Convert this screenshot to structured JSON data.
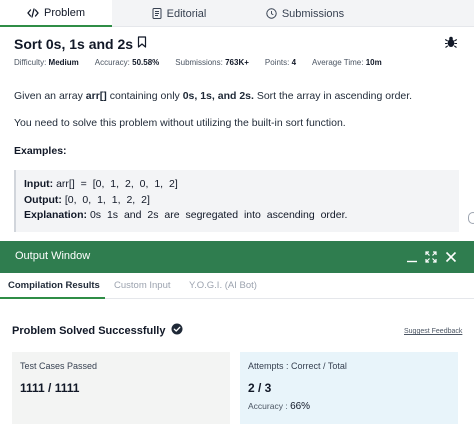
{
  "tabs": {
    "problem": "Problem",
    "editorial": "Editorial",
    "submissions": "Submissions"
  },
  "problem": {
    "title": "Sort 0s, 1s and 2s",
    "meta": {
      "difficulty_label": "Difficulty:",
      "difficulty": "Medium",
      "accuracy_label": "Accuracy:",
      "accuracy": "50.58%",
      "submissions_label": "Submissions:",
      "submissions": "763K+",
      "points_label": "Points:",
      "points": "4",
      "avg_time_label": "Average Time:",
      "avg_time": "10m"
    },
    "desc_pre": "Given an array ",
    "desc_arr": "arr[]",
    "desc_mid": " containing only ",
    "desc_vals": "0s, 1s, and 2s.",
    "desc_post": " Sort the array in ascending order.",
    "note": "You need to solve this problem without utilizing the built-in sort function.",
    "examples_heading": "Examples:",
    "example": {
      "input_label": "Input:",
      "input_value": "arr[] = [0, 1, 2, 0, 1, 2]",
      "output_label": "Output:",
      "output_value": "[0, 0, 1, 1, 2, 2]",
      "explanation_label": "Explanation:",
      "explanation_value": "0s 1s and 2s are segregated into ascending order."
    }
  },
  "output_window": {
    "title": "Output Window",
    "tabs": {
      "compilation": "Compilation Results",
      "custom": "Custom Input",
      "yogi": "Y.O.G.I. (AI Bot)"
    },
    "status": "Problem Solved Successfully",
    "suggest_feedback": "Suggest Feedback",
    "test_cases": {
      "label": "Test Cases Passed",
      "value": "1111 / 1111"
    },
    "attempts": {
      "label": "Attempts : Correct / Total",
      "value": "2 / 3",
      "accuracy_label": "Accuracy :",
      "accuracy_value": "66%"
    }
  },
  "colors": {
    "accent_green": "#2f8d46",
    "header_green": "#2f7d4f",
    "tests_card_bg": "#f3f4f3",
    "attempts_card_bg": "#e8f4fa"
  },
  "icons": [
    "code-icon",
    "document-icon",
    "clock-icon",
    "bookmark-icon",
    "bug-icon",
    "check-circle-icon",
    "minimize-icon",
    "expand-icon",
    "close-icon"
  ]
}
